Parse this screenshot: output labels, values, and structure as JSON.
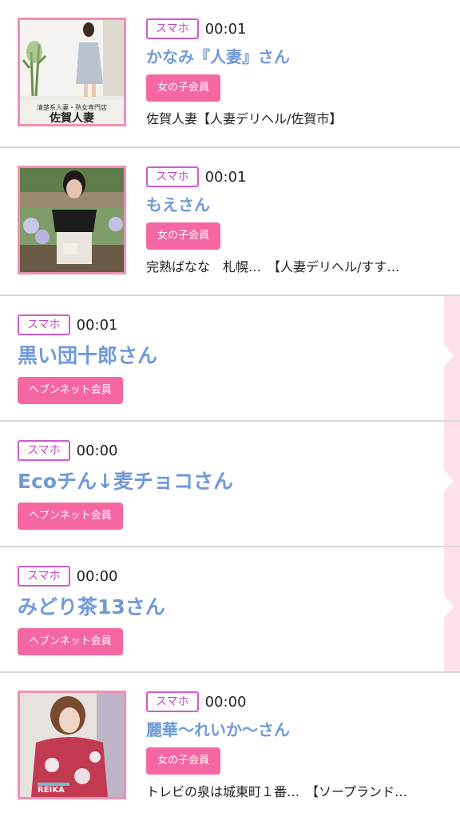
{
  "entries": [
    {
      "device": "スマホ",
      "time": "00:01",
      "name": "かなみ『人妻』さん",
      "member_type": "女の子会員",
      "shop": "佐賀人妻【人妻デリヘル/佐賀市】",
      "thumb_text": "清楚系人妻・熟女専門店",
      "thumb_logo": "佐賀人妻"
    },
    {
      "device": "スマホ",
      "time": "00:01",
      "name": "もえさん",
      "member_type": "女の子会員",
      "shop": "完熟ばなな　札幌…　【人妻デリヘル/すす…"
    },
    {
      "device": "スマホ",
      "time": "00:01",
      "name": "黒い団十郎さん",
      "member_type": "ヘブンネット会員"
    },
    {
      "device": "スマホ",
      "time": "00:00",
      "name": "Ecoチん↓麦チョコさん",
      "member_type": "ヘブンネット会員"
    },
    {
      "device": "スマホ",
      "time": "00:00",
      "name": "みどり茶13さん",
      "member_type": "ヘブンネット会員"
    },
    {
      "device": "スマホ",
      "time": "00:00",
      "name": "麗華〜れいか〜さん",
      "member_type": "女の子会員",
      "shop": "トレビの泉は城東町１番…　【ソープランド…",
      "thumb_logo": "REIKA"
    }
  ],
  "colors": {
    "device_badge": "#c249c4",
    "name": "#6f9ad7",
    "member_badge": "#f567a3",
    "side_tab": "#fde0ea"
  }
}
